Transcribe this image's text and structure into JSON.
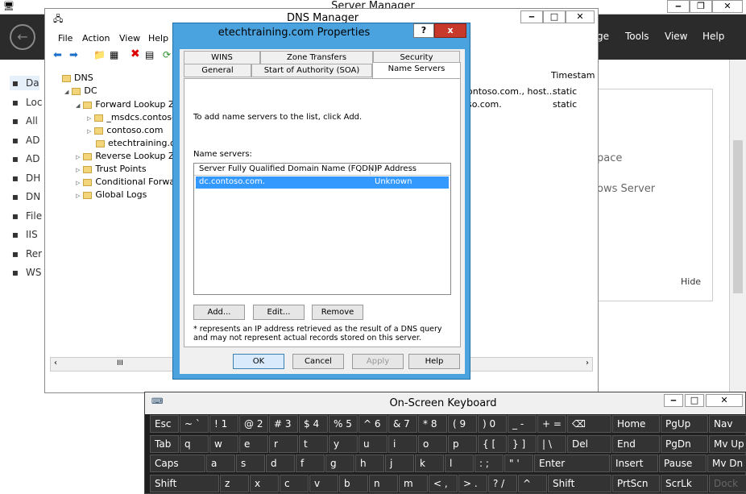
{
  "server_manager": {
    "title": "Server Manager",
    "nav": [
      "ge",
      "Tools",
      "View",
      "Help"
    ],
    "sidebar": [
      {
        "label": "Da",
        "icon": "dashboard-icon"
      },
      {
        "label": "Loc",
        "icon": "local-server-icon"
      },
      {
        "label": "All",
        "icon": "all-servers-icon"
      },
      {
        "label": "AD",
        "icon": "ad-cs-icon"
      },
      {
        "label": "AD",
        "icon": "ad-ds-icon"
      },
      {
        "label": "DH",
        "icon": "dhcp-icon"
      },
      {
        "label": "DN",
        "icon": "dns-icon"
      },
      {
        "label": "File",
        "icon": "file-services-icon"
      },
      {
        "label": "IIS",
        "icon": "iis-icon"
      },
      {
        "label": "Rer",
        "icon": "remote-access-icon"
      },
      {
        "label": "WS",
        "icon": "wsus-icon"
      }
    ],
    "bg_texts": [
      "pace",
      "ows Server",
      "Hide"
    ]
  },
  "dns_manager": {
    "title": "DNS Manager",
    "menu": [
      "File",
      "Action",
      "View",
      "Help"
    ],
    "tree": [
      {
        "label": "DNS",
        "indent": 0
      },
      {
        "label": "DC",
        "indent": 1
      },
      {
        "label": "Forward Lookup Zon",
        "indent": 2
      },
      {
        "label": "_msdcs.contoso",
        "indent": 3
      },
      {
        "label": "contoso.com",
        "indent": 3
      },
      {
        "label": "etechtraining.co",
        "indent": 3
      },
      {
        "label": "Reverse Lookup Zon",
        "indent": 2
      },
      {
        "label": "Trust Points",
        "indent": 2
      },
      {
        "label": "Conditional Forward",
        "indent": 2
      },
      {
        "label": "Global Logs",
        "indent": 2
      }
    ],
    "list_header": "Timestam",
    "rows": [
      {
        "data": "ontoso.com., host...",
        "ts": "static"
      },
      {
        "data": "so.com.",
        "ts": "static"
      }
    ],
    "scroll_mid": "III"
  },
  "dialog": {
    "title": "etechtraining.com Properties",
    "help": "?",
    "close": "x",
    "tabs_top": [
      "WINS",
      "Zone Transfers",
      "Security"
    ],
    "tabs_bottom": [
      "General",
      "Start of Authority (SOA)",
      "Name Servers"
    ],
    "instruction": "To add name servers to the list, click Add.",
    "ns_label": "Name servers:",
    "col1": "Server Fully Qualified Domain Name (FQDN)",
    "col2": "IP Address",
    "row_fqdn": "dc.contoso.com.",
    "row_ip": "Unknown",
    "add": "Add...",
    "edit": "Edit...",
    "remove": "Remove",
    "note": "* represents an IP address retrieved as the result of a DNS query and may not represent actual records stored on this server.",
    "ok": "OK",
    "cancel": "Cancel",
    "apply": "Apply",
    "helpbtn": "Help"
  },
  "osk": {
    "title": "On-Screen Keyboard",
    "rows": [
      [
        "Esc",
        "~ `",
        "! 1",
        "@ 2",
        "# 3",
        "$ 4",
        "% 5",
        "^ 6",
        "& 7",
        "* 8",
        "( 9",
        ") 0",
        "_ -",
        "+ =",
        "⌫",
        "Home",
        "PgUp",
        "Nav"
      ],
      [
        "Tab",
        "q",
        "w",
        "e",
        "r",
        "t",
        "y",
        "u",
        "i",
        "o",
        "p",
        "{ [",
        "} ]",
        "| \\",
        "Del",
        "End",
        "PgDn",
        "Mv Up"
      ],
      [
        "Caps",
        "a",
        "s",
        "d",
        "f",
        "g",
        "h",
        "j",
        "k",
        "l",
        ": ;",
        "\" '",
        "Enter",
        "Insert",
        "Pause",
        "Mv Dn"
      ],
      [
        "Shift",
        "z",
        "x",
        "c",
        "v",
        "b",
        "n",
        "m",
        "< ,",
        "> .",
        "? /",
        "^",
        "Shift",
        "PrtScn",
        "ScrLk",
        "Dock"
      ]
    ]
  }
}
